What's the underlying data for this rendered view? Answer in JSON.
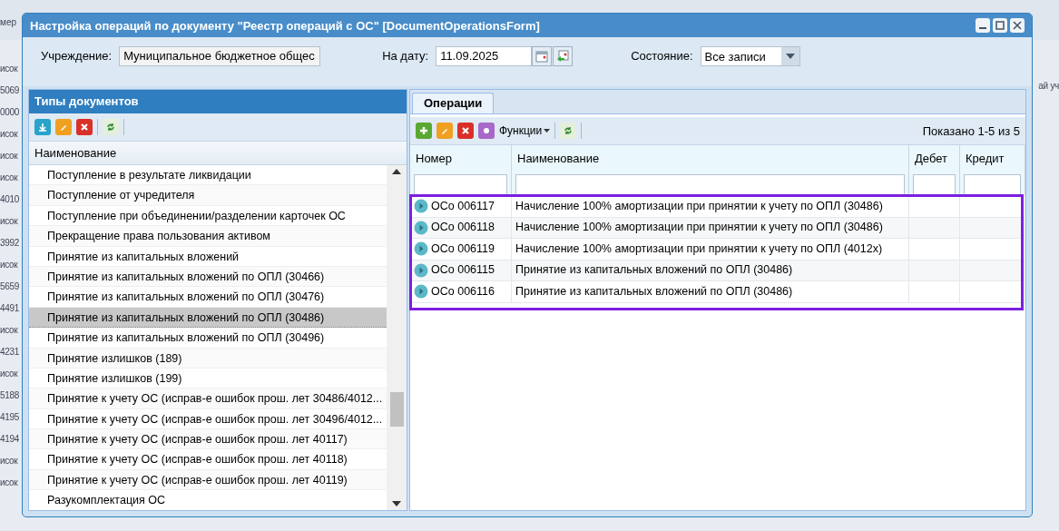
{
  "background": {
    "header_cells": [
      "мер"
    ],
    "left_cells": [
      "исок",
      "5069",
      "0000",
      "исок",
      "исок",
      "исок",
      "4010",
      "исок",
      "3992",
      "исок",
      "5659",
      "4491",
      "исок",
      "4231",
      "исок",
      "5188",
      "4195",
      "4194",
      "исок",
      "исок"
    ],
    "right_text": "ай уч"
  },
  "window": {
    "title": "Настройка операций по документу \"Реестр операций с ОС\" [DocumentOperationsForm]"
  },
  "filters": {
    "institution": {
      "label": "Учреждение:",
      "value": "Муниципальное бюджетное общес"
    },
    "date": {
      "label": "На дату:",
      "value": "11.09.2025"
    },
    "state": {
      "label": "Состояние:",
      "value": "Все записи"
    }
  },
  "doc_types": {
    "title": "Типы документов",
    "column": "Наименование",
    "items": [
      {
        "name": "Поступление в результате ликвидации",
        "selected": false
      },
      {
        "name": "Поступление от учредителя",
        "selected": false
      },
      {
        "name": "Поступление при объединении/разделении карточек ОС",
        "selected": false
      },
      {
        "name": "Прекращение права пользования активом",
        "selected": false
      },
      {
        "name": "Принятие из капитальных вложений",
        "selected": false
      },
      {
        "name": "Принятие из капитальных вложений по ОПЛ (30466)",
        "selected": false
      },
      {
        "name": "Принятие из капитальных вложений по ОПЛ (30476)",
        "selected": false
      },
      {
        "name": "Принятие из капитальных вложений по ОПЛ (30486)",
        "selected": true
      },
      {
        "name": "Принятие из капитальных вложений по ОПЛ (30496)",
        "selected": false
      },
      {
        "name": "Принятие излишков (189)",
        "selected": false
      },
      {
        "name": "Принятие излишков (199)",
        "selected": false
      },
      {
        "name": "Принятие к учету ОС (исправ-е ошибок прош. лет 30486/4012...",
        "selected": false
      },
      {
        "name": "Принятие к учету ОС (исправ-е ошибок прош. лет 30496/4012...",
        "selected": false
      },
      {
        "name": "Принятие к учету ОС (исправ-е ошибок прош. лет 40117)",
        "selected": false
      },
      {
        "name": "Принятие к учету ОС (исправ-е ошибок прош. лет 40118)",
        "selected": false
      },
      {
        "name": "Принятие к учету ОС (исправ-е ошибок прош. лет 40119)",
        "selected": false
      },
      {
        "name": "Разукомплектация ОС",
        "selected": false
      }
    ]
  },
  "operations": {
    "tabs": [
      {
        "label": "Операции",
        "selected": true
      }
    ],
    "functions_label": "Функции",
    "paging": "Показано 1-5 из 5",
    "columns": [
      "Номер",
      "Наименование",
      "Дебет",
      "Кредит"
    ],
    "rows": [
      {
        "number": "ОСо 006117",
        "name": "Начисление 100% амортизации при принятии к учету по ОПЛ (30486)"
      },
      {
        "number": "ОСо 006118",
        "name": "Начисление 100% амортизации при принятии к учету по ОПЛ (30486)"
      },
      {
        "number": "ОСо 006119",
        "name": "Начисление 100% амортизации при принятии к учету по ОПЛ (4012х)"
      },
      {
        "number": "ОСо 006115",
        "name": "Принятие из капитальных вложений по ОПЛ (30486)"
      },
      {
        "number": "ОСо 006116",
        "name": "Принятие из капитальных вложений по ОПЛ (30486)"
      }
    ]
  }
}
